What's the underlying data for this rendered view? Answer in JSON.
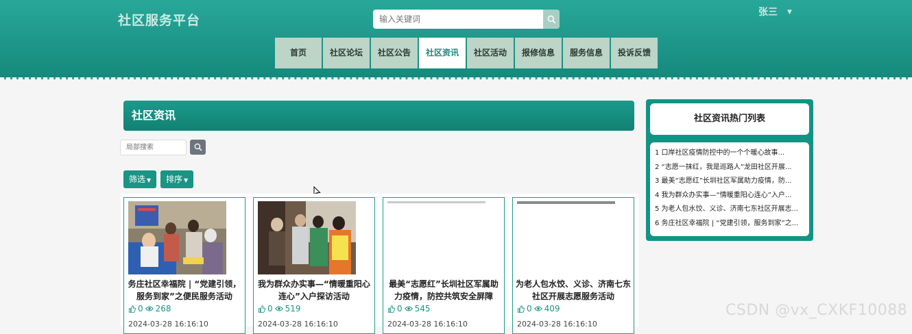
{
  "header": {
    "brand": "社区服务平台",
    "search_placeholder": "输入关键词",
    "user_name": "张三",
    "nav": [
      {
        "label": "首页",
        "active": false
      },
      {
        "label": "社区论坛",
        "active": false
      },
      {
        "label": "社区公告",
        "active": false
      },
      {
        "label": "社区资讯",
        "active": true
      },
      {
        "label": "社区活动",
        "active": false
      },
      {
        "label": "报修信息",
        "active": false
      },
      {
        "label": "服务信息",
        "active": false
      },
      {
        "label": "投诉反馈",
        "active": false
      }
    ]
  },
  "main": {
    "title": "社区资讯",
    "local_search_placeholder": "局部搜索",
    "filter_label": "筛选",
    "sort_label": "排序",
    "cards": [
      {
        "title": "务庄社区幸福院 | “党建引领，服务到家”之便民服务活动",
        "likes": "0",
        "views": "268",
        "date": "2024-03-28 16:16:10"
      },
      {
        "title": "我为群众办实事—“情暖重阳心连心”入户探访活动",
        "likes": "0",
        "views": "519",
        "date": "2024-03-28 16:16:10"
      },
      {
        "title": "最美“志愿红”长圳社区军属助力疫情，防控共筑安全屏障",
        "likes": "0",
        "views": "545",
        "date": "2024-03-28 16:16:10"
      },
      {
        "title": "为老人包水饺、义诊、济南七东社区开展志愿服务活动",
        "likes": "0",
        "views": "409",
        "date": "2024-03-28 16:16:10"
      }
    ]
  },
  "sidebar": {
    "title": "社区资讯热门列表",
    "items": [
      "1  口岸社区疫情防控中的一个个暖心故事...",
      "2  “志愿一抹红，我是巡路人”龙田社区开展...",
      "3  最美“志愿红”长圳社区军属助力疫情，防...",
      "4  我为群众办实事—“情暖重阳心连心”入户...",
      "5  为老人包水饺、义诊、济南七东社区开展志...",
      "6  务庄社区幸福院 | “党建引领，服务到家”之..."
    ]
  },
  "watermark": "CSDN @vx_CXKF10088",
  "icons": {
    "search": "search-icon",
    "like": "thumbs-up-icon",
    "views": "eye-icon",
    "caret": "caret-down-icon"
  },
  "colors": {
    "primary": "#15897c",
    "nav_bg": "#bcd5c6",
    "accent_green": "#1a9484"
  }
}
